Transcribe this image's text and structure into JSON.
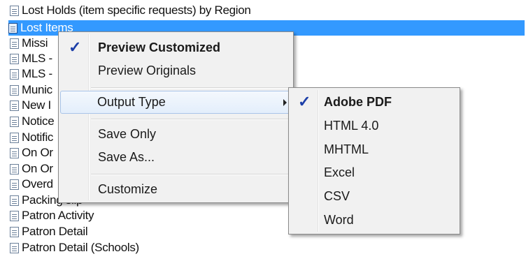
{
  "report_list": {
    "items": [
      {
        "label": "Lost Holds (item specific requests) by Region",
        "selected": false
      },
      {
        "label": "Lost Items",
        "selected": true
      },
      {
        "label": "Missi",
        "selected": false
      },
      {
        "label": "MLS -",
        "selected": false
      },
      {
        "label": "MLS -",
        "selected": false
      },
      {
        "label": "Munic",
        "selected": false
      },
      {
        "label": "New I",
        "selected": false
      },
      {
        "label": "Notice",
        "selected": false
      },
      {
        "label": "Notific",
        "selected": false
      },
      {
        "label": "On Or",
        "selected": false
      },
      {
        "label": "On Or",
        "selected": false
      },
      {
        "label": "Overd",
        "selected": false
      },
      {
        "label": "Packing slip",
        "selected": false
      },
      {
        "label": "Patron Activity",
        "selected": false
      },
      {
        "label": "Patron Detail",
        "selected": false
      },
      {
        "label": "Patron Detail (Schools)",
        "selected": false
      }
    ],
    "item_icon": "report-document-icon",
    "selection_color": "#3399ff"
  },
  "context_menu": {
    "preview_customized": "Preview Customized",
    "preview_originals": "Preview Originals",
    "output_type": "Output Type",
    "save_only": "Save Only",
    "save_as": "Save As...",
    "customize": "Customize",
    "checked_item": "Preview Customized",
    "check_glyph": "✓"
  },
  "output_type_submenu": {
    "items": [
      "Adobe PDF",
      "HTML 4.0",
      "MHTML",
      "Excel",
      "CSV",
      "Word"
    ],
    "checked_item": "Adobe PDF",
    "check_glyph": "✓"
  },
  "colors": {
    "menu_background": "#f1f1f1",
    "check_mark": "#1c3fa8",
    "hover_border": "#a9c4e8"
  }
}
